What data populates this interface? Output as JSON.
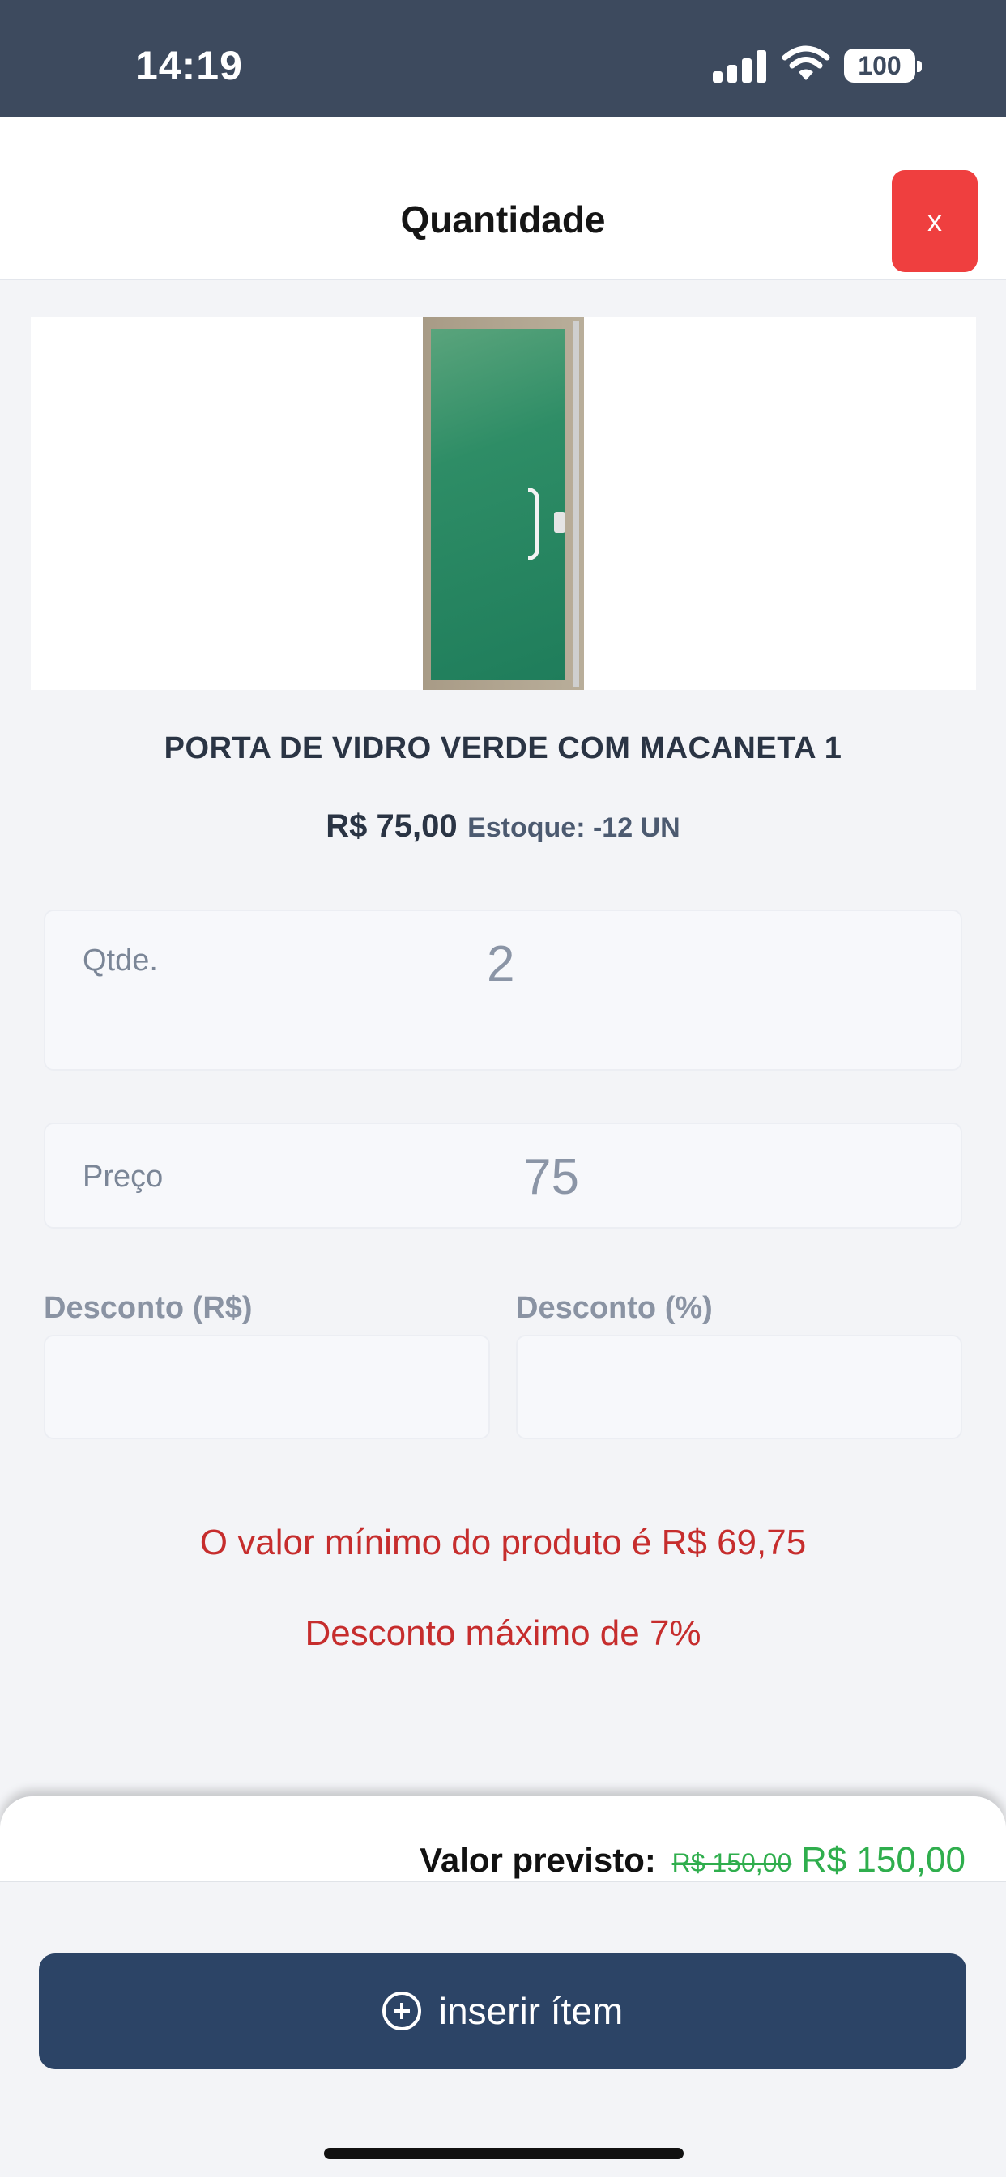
{
  "status_bar": {
    "time": "14:19",
    "battery": "100"
  },
  "header": {
    "title": "Quantidade",
    "close_label": "x"
  },
  "product": {
    "name": "PORTA DE VIDRO VERDE COM MACANETA 1",
    "price": "R$ 75,00",
    "stock": "Estoque: -12 UN"
  },
  "form": {
    "qty_label": "Qtde.",
    "qty_value": "2",
    "price_label": "Preço",
    "price_value": "75",
    "discount_rs_label": "Desconto (R$)",
    "discount_rs_value": "",
    "discount_pct_label": "Desconto (%)",
    "discount_pct_value": ""
  },
  "warnings": {
    "min_value": "O valor mínimo do produto é R$ 69,75",
    "max_discount": "Desconto máximo de 7%"
  },
  "summary": {
    "label": "Valor previsto:",
    "old_total": "R$ 150,00",
    "new_total": "R$ 150,00"
  },
  "actions": {
    "insert_label": "inserir ítem"
  },
  "colors": {
    "accent": "#2c4466",
    "danger": "#ef3f3f",
    "warning_text": "#c62d2d",
    "success": "#2fae4d",
    "status_bar": "#3d4a5e"
  }
}
